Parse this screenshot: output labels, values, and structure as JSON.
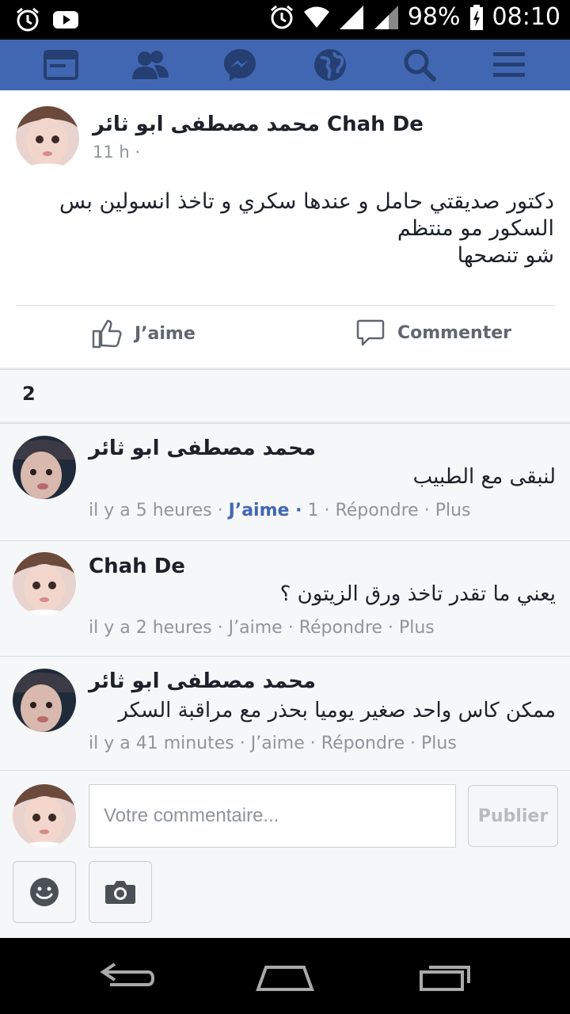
{
  "status_bar": {
    "battery": "98%",
    "time": "08:10"
  },
  "nav": [
    "feed-icon",
    "friends-icon",
    "messenger-icon",
    "globe-icon",
    "search-icon",
    "menu-icon"
  ],
  "post": {
    "author": "محمد مصطفى ابو ثائر Chah De",
    "time": "11 h ·",
    "text_line1": "دكتور صديقتي حامل و عندها سكري و تاخذ انسولين بس",
    "text_line2": "السكور مو منتظم",
    "text_line3": "شو تنصحها",
    "like_label": "J’aime",
    "comment_label": "Commenter"
  },
  "comments_count": "2",
  "comments": [
    {
      "name": "محمد مصطفى ابو ثائر",
      "text": "لنبقى مع الطبيب",
      "time": "il y a 5 heures",
      "like": "J’aime ·",
      "likes_count": "1",
      "reply": "Répondre",
      "more": "Plus"
    },
    {
      "name": "Chah De",
      "text": "يعني ما تقدر تاخذ ورق الزيتون ؟",
      "time": "il y a 2 heures",
      "like": "J’aime",
      "reply": "Répondre",
      "more": "Plus"
    },
    {
      "name": "محمد مصطفى ابو ثائر",
      "text": "ممكن كاس واحد صغير يوميا بحذر مع مراقبة السكر",
      "time": "il y a 41 minutes",
      "like": "J’aime",
      "reply": "Répondre",
      "more": "Plus"
    }
  ],
  "composer": {
    "placeholder": "Votre commentaire...",
    "publish": "Publier"
  },
  "colors": {
    "brand": "#4267b2",
    "liked": "#4267b2"
  }
}
